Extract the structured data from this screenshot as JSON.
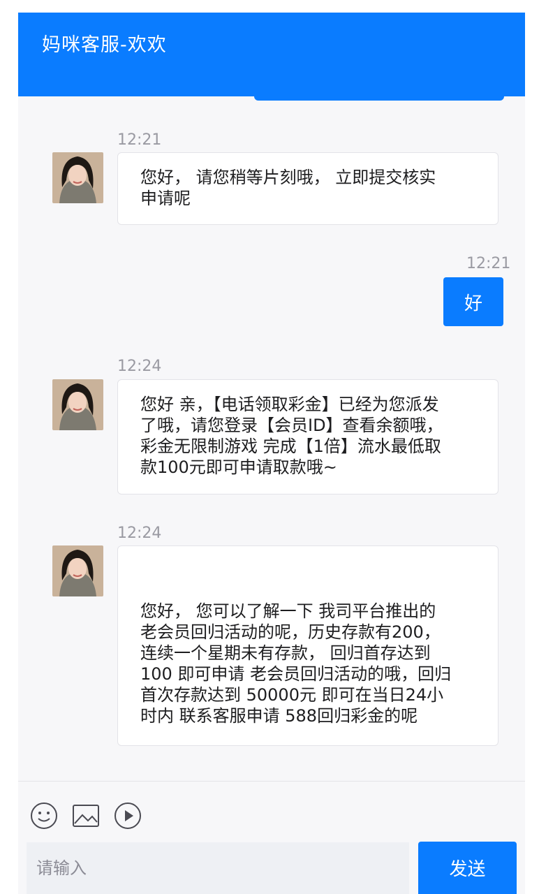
{
  "header": {
    "title": "妈咪客服-欢欢"
  },
  "messages": [
    {
      "time": "12:21",
      "sender": "agent",
      "text": "您好， 请您稍等片刻哦， 立即提交核实\n申请呢"
    },
    {
      "time": "12:21",
      "sender": "user",
      "text": "好"
    },
    {
      "time": "12:24",
      "sender": "agent",
      "text": "您好 亲，【电话领取彩金】已经为您派发\n了哦，请您登录【会员ID】查看余额哦，\n彩金无限制游戏 完成【1倍】流水最低取\n款100元即可申请取款哦~"
    },
    {
      "time": "12:24",
      "sender": "agent",
      "text": "您好， 您可以了解一下 我司平台推出的\n老会员回归活动的呢，历史存款有200，\n连续一个星期未有存款， 回归首存达到\n100 即可申请 老会员回归活动的哦，回归\n首次存款达到 50000元 即可在当日24小\n时内 联系客服申请 588回归彩金的呢"
    }
  ],
  "toolbar": {
    "icons": [
      "emoji-icon",
      "image-icon",
      "play-icon"
    ]
  },
  "composer": {
    "placeholder": "请输入",
    "value": "",
    "send_label": "发送"
  },
  "colors": {
    "brand": "#0a7cff",
    "background": "#f7f7f9",
    "bubble": "#ffffff"
  }
}
